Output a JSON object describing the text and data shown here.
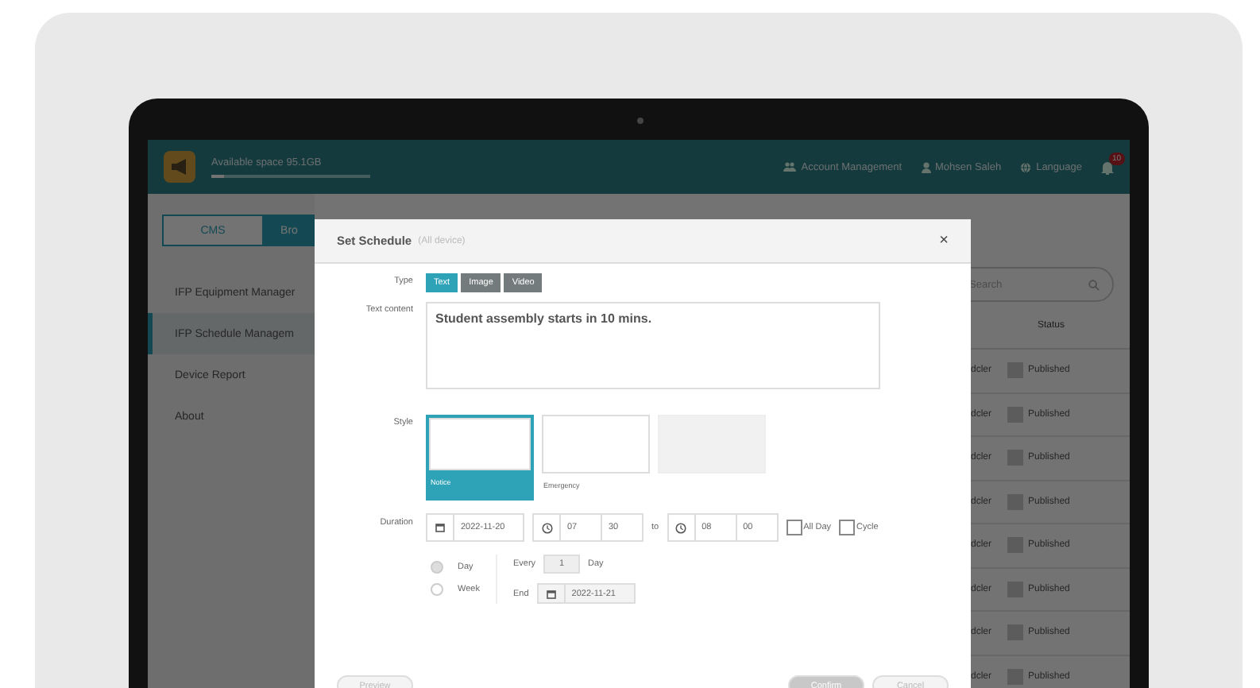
{
  "header": {
    "storage": {
      "label": "Available space 95.1GB",
      "level": 0.08
    },
    "links": [
      {
        "kind": "account",
        "label": "Account Management"
      },
      {
        "kind": "user",
        "label": "Mohsen Saleh"
      },
      {
        "kind": "language",
        "label": "Language"
      }
    ],
    "notifications": {
      "count": "10"
    }
  },
  "mode_tabs": [
    {
      "label": "CMS",
      "selected": false
    },
    {
      "label": "Bro",
      "selected": true
    }
  ],
  "sidebar": {
    "items": [
      {
        "label": "IFP Equipment Manager",
        "selected": false
      },
      {
        "label": "IFP Schedule Managem",
        "selected": true
      },
      {
        "label": "Device Report",
        "selected": false
      },
      {
        "label": "About",
        "selected": false
      }
    ]
  },
  "table": {
    "search": {
      "placeholder": "Search"
    },
    "columns": [
      "Status"
    ],
    "rows": [
      {
        "column_1": "dcler",
        "status": "Published"
      },
      {
        "column_1": "dcler",
        "status": "Published"
      },
      {
        "column_1": "dcler",
        "status": "Published"
      },
      {
        "column_1": "dcler",
        "status": "Published"
      },
      {
        "column_1": "dcler",
        "status": "Published"
      },
      {
        "column_1": "dcler",
        "status": "Published"
      },
      {
        "column_1": "dcler",
        "status": "Published"
      },
      {
        "column_1": "dcler",
        "status": "Published"
      }
    ]
  },
  "dialog": {
    "title": "Set Schedule",
    "subtitle": "(All device)",
    "close": "×",
    "type": {
      "label": "Type",
      "options": [
        {
          "label": "Text",
          "selected": true
        },
        {
          "label": "Image",
          "selected": false
        },
        {
          "label": "Video",
          "selected": false
        }
      ]
    },
    "text_content": {
      "label": "Text content",
      "value": "Student assembly starts in 10 mins."
    },
    "style": {
      "label": "Style",
      "options": [
        {
          "label": "Notice",
          "selected": true,
          "disabled": false
        },
        {
          "label": "Emergency",
          "selected": false,
          "disabled": false
        },
        {
          "selected": false,
          "disabled": true
        }
      ]
    },
    "duration": {
      "label": "Duration",
      "date": "2022-11-20",
      "start_hour": "07",
      "start_minute": "30",
      "separator": "to",
      "end_hour": "08",
      "end_minute": "00",
      "all_day": {
        "label": "All Day",
        "checked": false
      },
      "cycle": {
        "label": "Cycle",
        "checked": false
      }
    },
    "repeat": {
      "options": [
        {
          "label": "Day",
          "selected": true
        },
        {
          "label": "Week",
          "selected": false
        }
      ],
      "every_label": "Every",
      "every_value": "1",
      "every_unit": "Day",
      "end_label": "End",
      "end_date": "2022-11-21"
    },
    "buttons": [
      {
        "label": "Preview",
        "kind": "secondary"
      },
      {
        "label": "Confirm",
        "kind": "primary"
      },
      {
        "label": "Cancel",
        "kind": "secondary"
      }
    ]
  }
}
